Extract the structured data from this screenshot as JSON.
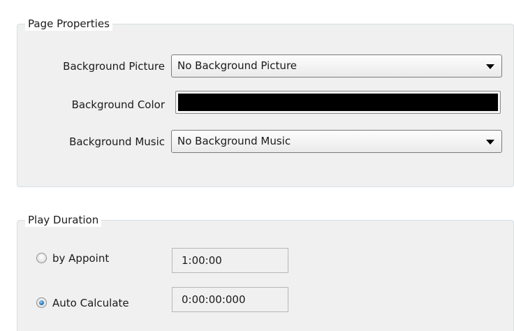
{
  "page_properties": {
    "title": "Page Properties",
    "background_picture": {
      "label": "Background Picture",
      "value": "No Background Picture"
    },
    "background_color": {
      "label": "Background Color",
      "color": "#000000"
    },
    "background_music": {
      "label": "Background Music",
      "value": "No Background Music"
    }
  },
  "play_duration": {
    "title": "Play Duration",
    "by_appoint": {
      "label": "by Appoint",
      "checked": false,
      "value": "1:00:00"
    },
    "auto_calculate": {
      "label": "Auto Calculate",
      "checked": true,
      "value": "0:00:00:000"
    }
  }
}
